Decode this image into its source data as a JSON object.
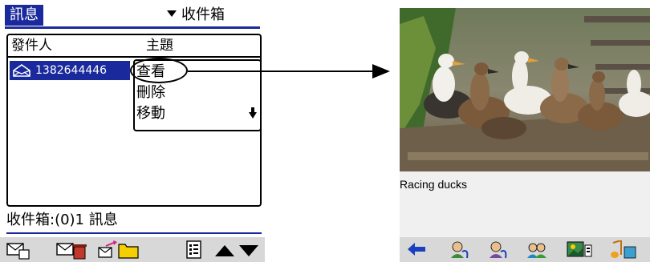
{
  "left_screen": {
    "app_title": "訊息",
    "category": "收件箱",
    "columns": {
      "sender": "發件人",
      "subject": "主題"
    },
    "message": {
      "sender": "1382644446"
    },
    "context_menu": [
      "查看",
      "刪除",
      "移動"
    ],
    "status": "收件箱:(0)1 訊息",
    "toolbar_icons": [
      "new-message-icon",
      "delete-message-icon",
      "move-to-folder-icon",
      "details-icon",
      "scroll-up-icon",
      "scroll-down-icon"
    ]
  },
  "right_screen": {
    "caption": "Racing ducks",
    "toolbar_icons": [
      "back-arrow-icon",
      "contact-icon-1",
      "contact-icon-2",
      "contact-icon-3",
      "image-icon",
      "music-note-icon"
    ]
  },
  "colors": {
    "accent": "#1a2a9c",
    "toolbar": "#d8d8d8",
    "caption_bg": "#f0f0f0"
  }
}
